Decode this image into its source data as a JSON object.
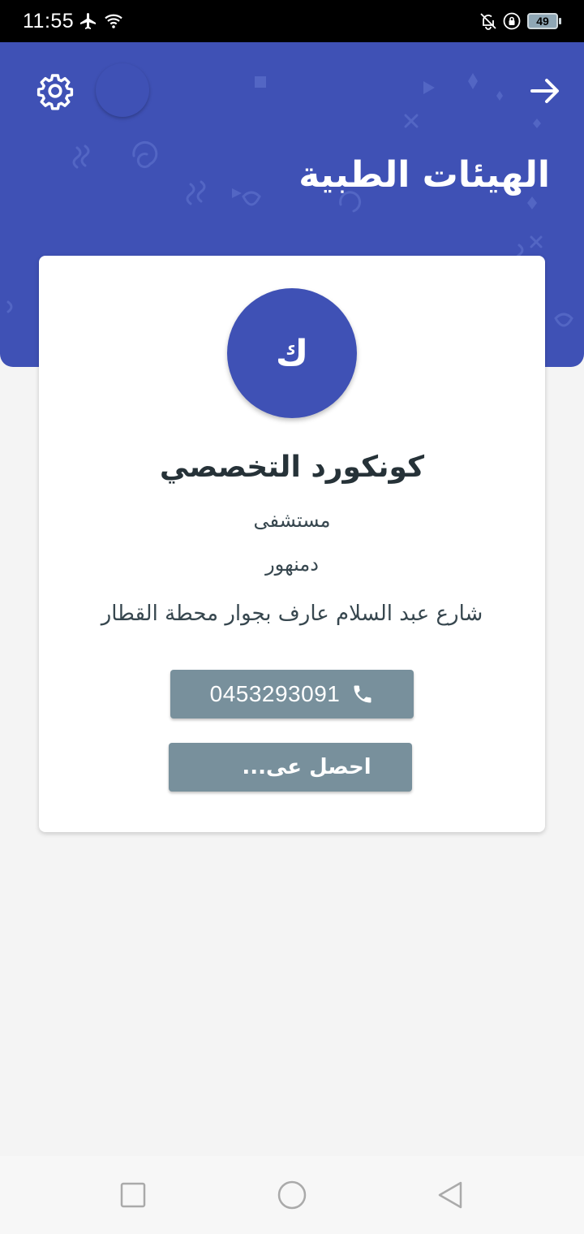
{
  "status_bar": {
    "time": "11:55",
    "battery": "49",
    "icons": [
      "airplane-icon",
      "wifi-icon",
      "bell-off-icon",
      "lock-rotation-icon",
      "battery-icon"
    ]
  },
  "header": {
    "title": "الهيئات الطبية",
    "color": "#3f51b5",
    "icons": [
      "gear-icon",
      "arrow-right-icon"
    ]
  },
  "card": {
    "avatar_letter": "ك",
    "name": "كونكورد التخصصي",
    "type": "مستشفى",
    "city": "دمنهور",
    "address": "شارع عبد السلام عارف بجوار محطة القطار",
    "phone": "0453293091",
    "directions_label": "احصل عى..."
  },
  "colors": {
    "accent": "#3f51b5",
    "button": "#78909c",
    "background": "#f4f4f4"
  },
  "nav_bar": {
    "icons": [
      "square-icon",
      "circle-icon",
      "triangle-back-icon"
    ]
  }
}
